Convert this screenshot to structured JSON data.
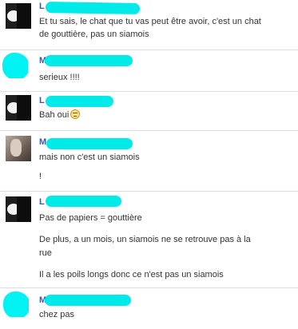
{
  "messages": [
    {
      "name": "L",
      "avatar": "dark-portrait-avatar",
      "lines": [
        "Et tu sais, le chat que tu vas peut être avoir, c'est un chat",
        "de gouttière, pas un siamois"
      ]
    },
    {
      "name": "M",
      "avatar": "teal-scribbled-avatar",
      "lines": [
        "serieux !!!!"
      ]
    },
    {
      "name": "L",
      "avatar": "dark-portrait-avatar",
      "lines": [
        "Bah oui"
      ],
      "emoji": "unamused-face"
    },
    {
      "name": "M",
      "avatar": "photo-avatar",
      "lines": [
        "mais non c'est un siamois",
        "!"
      ]
    },
    {
      "name": "L",
      "avatar": "dark-portrait-avatar",
      "lines": [
        "Pas de papiers = gouttière",
        "De plus, a un mois, un siamois ne se retrouve pas à la",
        "rue",
        "Il a les poils longs donc ce n'est pas un siamois"
      ]
    },
    {
      "name": "M",
      "avatar": "teal-scribbled-avatar",
      "lines": [
        "chez pas"
      ]
    }
  ],
  "colors": {
    "name": "#3b5998",
    "text": "#333333",
    "scribble": "#00eaea",
    "separator": "#d9dde6"
  }
}
